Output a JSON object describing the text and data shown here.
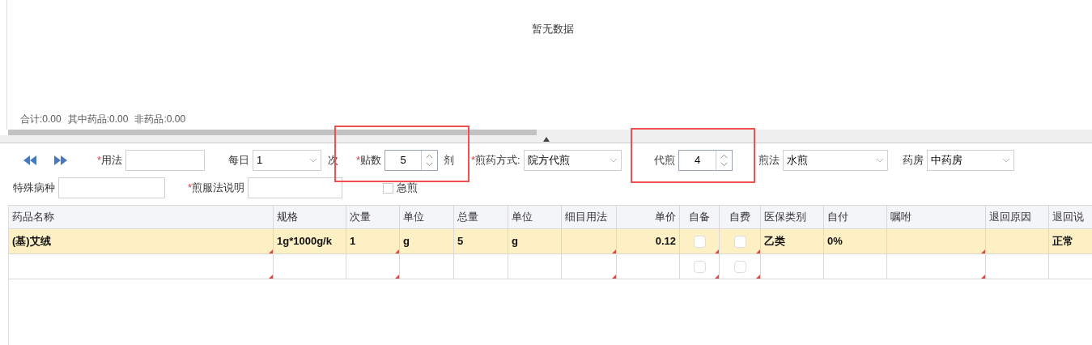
{
  "top_panel": {
    "empty_text": "暂无数据",
    "totals": [
      "合计:0.00",
      "其中药品:0.00",
      "非药品:0.00"
    ]
  },
  "form_rows": [
    [
      {
        "kind": "nav"
      },
      {
        "kind": "input",
        "required_mark": "*",
        "label": "用法"
      },
      {
        "kind": "select",
        "label": "每日",
        "value": "1"
      },
      {
        "kind": "text",
        "label": "次"
      },
      {
        "kind": "spinner",
        "required_mark": "*",
        "label": "贴数",
        "value": "5"
      },
      {
        "kind": "text",
        "label": "剂"
      },
      {
        "kind": "select",
        "required_mark": "*",
        "label": "煎药方式:",
        "value": "院方代煎"
      },
      {
        "kind": "spinner",
        "label": "代煎",
        "value": "4"
      },
      {
        "kind": "select",
        "label": "煎法",
        "value": "水煎"
      },
      {
        "kind": "select",
        "label": "药房",
        "value": "中药房"
      }
    ],
    [
      {
        "kind": "input",
        "label": "特殊病种"
      },
      {
        "kind": "input",
        "required_mark": "*",
        "label": "煎服法说明"
      },
      {
        "kind": "checkbox",
        "label": "急煎",
        "checked": false
      }
    ]
  ],
  "table": {
    "columns": [
      {
        "label": "药品名称",
        "kind": "text"
      },
      {
        "label": "规格",
        "kind": "text"
      },
      {
        "label": "次量",
        "kind": "text"
      },
      {
        "label": "单位",
        "kind": "text"
      },
      {
        "label": "总量",
        "kind": "text"
      },
      {
        "label": "单位",
        "kind": "text"
      },
      {
        "label": "细目用法",
        "kind": "text"
      },
      {
        "label": "单价",
        "kind": "number"
      },
      {
        "label": "自备",
        "kind": "checkbox"
      },
      {
        "label": "自费",
        "kind": "checkbox"
      },
      {
        "label": "医保类别",
        "kind": "text"
      },
      {
        "label": "自付",
        "kind": "text"
      },
      {
        "label": "嘱咐",
        "kind": "text"
      },
      {
        "label": "退回原因",
        "kind": "text"
      },
      {
        "label": "退回说",
        "kind": "text"
      }
    ],
    "rows": [
      {
        "selected": true,
        "cells": [
          {
            "text": "(基)艾绒",
            "marked": true
          },
          {
            "text": "1g*1000g/k",
            "marked": false
          },
          {
            "text": "1",
            "marked": true
          },
          {
            "text": "g",
            "marked": false
          },
          {
            "text": "5",
            "marked": false
          },
          {
            "text": "g",
            "marked": false
          },
          {
            "marked": true
          },
          {
            "text": "0.12",
            "marked": false
          },
          {
            "checked": false,
            "marked": true
          },
          {
            "checked": false,
            "marked": true
          },
          {
            "text": "乙类",
            "marked": false
          },
          {
            "text": "0%",
            "marked": false
          },
          {
            "marked": true
          },
          {
            "marked": false
          },
          {
            "text": "正常",
            "marked": false
          }
        ]
      },
      {
        "selected": false,
        "cells": [
          {
            "marked": true
          },
          {
            "marked": false
          },
          {
            "marked": true
          },
          {
            "marked": false
          },
          {
            "marked": false
          },
          {
            "marked": false
          },
          {
            "marked": true
          },
          {
            "marked": false
          },
          {
            "checked": false,
            "marked": true
          },
          {
            "checked": false,
            "marked": true
          },
          {
            "marked": false
          },
          {
            "marked": false
          },
          {
            "marked": true
          },
          {
            "marked": false
          },
          {
            "marked": false
          }
        ]
      }
    ]
  }
}
